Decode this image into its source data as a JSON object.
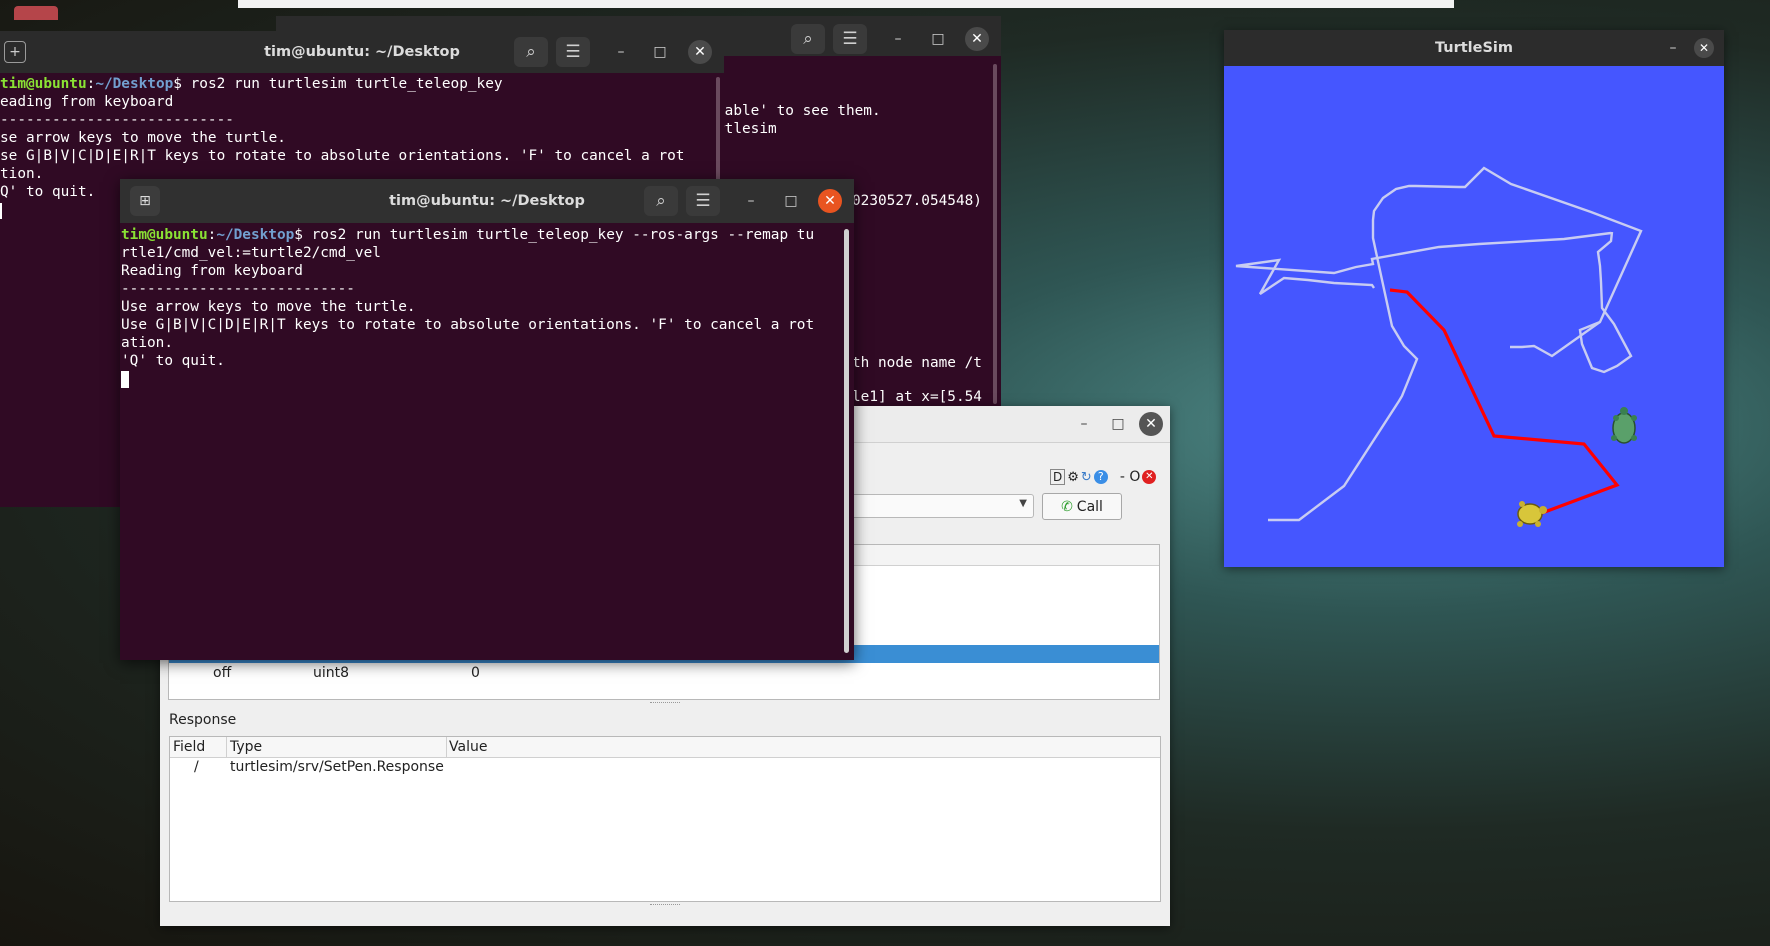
{
  "terminal_back": {
    "title": "tim@ubuntu: ~/Desktop",
    "prompt_user": "tim@ubuntu",
    "prompt_path": "~/Desktop",
    "command": "ros2 run turtlesim turtle_teleop_key",
    "lines": [
      "eading from keyboard",
      "---------------------------",
      "se arrow keys to move the turtle.",
      "se G|B|V|C|D|E|R|T keys to rotate to absolute orientations. 'F' to cancel a rot",
      "tion.",
      "Q' to quit."
    ]
  },
  "terminal_third": {
    "lines": [
      "lable' to see them.",
      "rtlesim",
      "0230527.054548)",
      "th node name /t",
      "le1] at x=[5.54"
    ]
  },
  "terminal_front": {
    "title": "tim@ubuntu: ~/Desktop",
    "prompt_user": "tim@ubuntu",
    "prompt_path": "~/Desktop",
    "command": "ros2 run turtlesim turtle_teleop_key --ros-args --remap tu",
    "lines": [
      "rtle1/cmd_vel:=turtle2/cmd_vel",
      "Reading from keyboard",
      "---------------------------",
      "Use arrow keys to move the turtle.",
      "Use G|B|V|C|D|E|R|T keys to rotate to absolute orientations. 'F' to cancel a rot",
      "ation.",
      "'Q' to quit."
    ]
  },
  "service_caller": {
    "toolbar_icons": [
      "D",
      "⚙",
      "↻",
      "?"
    ],
    "toolbar_text": "- O",
    "call_label": "Call",
    "request_row": {
      "field": "off",
      "type": "uint8",
      "value": "0"
    },
    "response_label": "Response",
    "response_columns": [
      "Field",
      "Type",
      "Value"
    ],
    "response_row": {
      "field": "/",
      "type": "turtlesim/srv/SetPen.Response",
      "value": ""
    }
  },
  "turtlesim": {
    "title": "TurtleSim",
    "background_color": "#4556ff",
    "trail_color_light": "#c8ccf2",
    "trail_color_red": "#ff0000"
  }
}
